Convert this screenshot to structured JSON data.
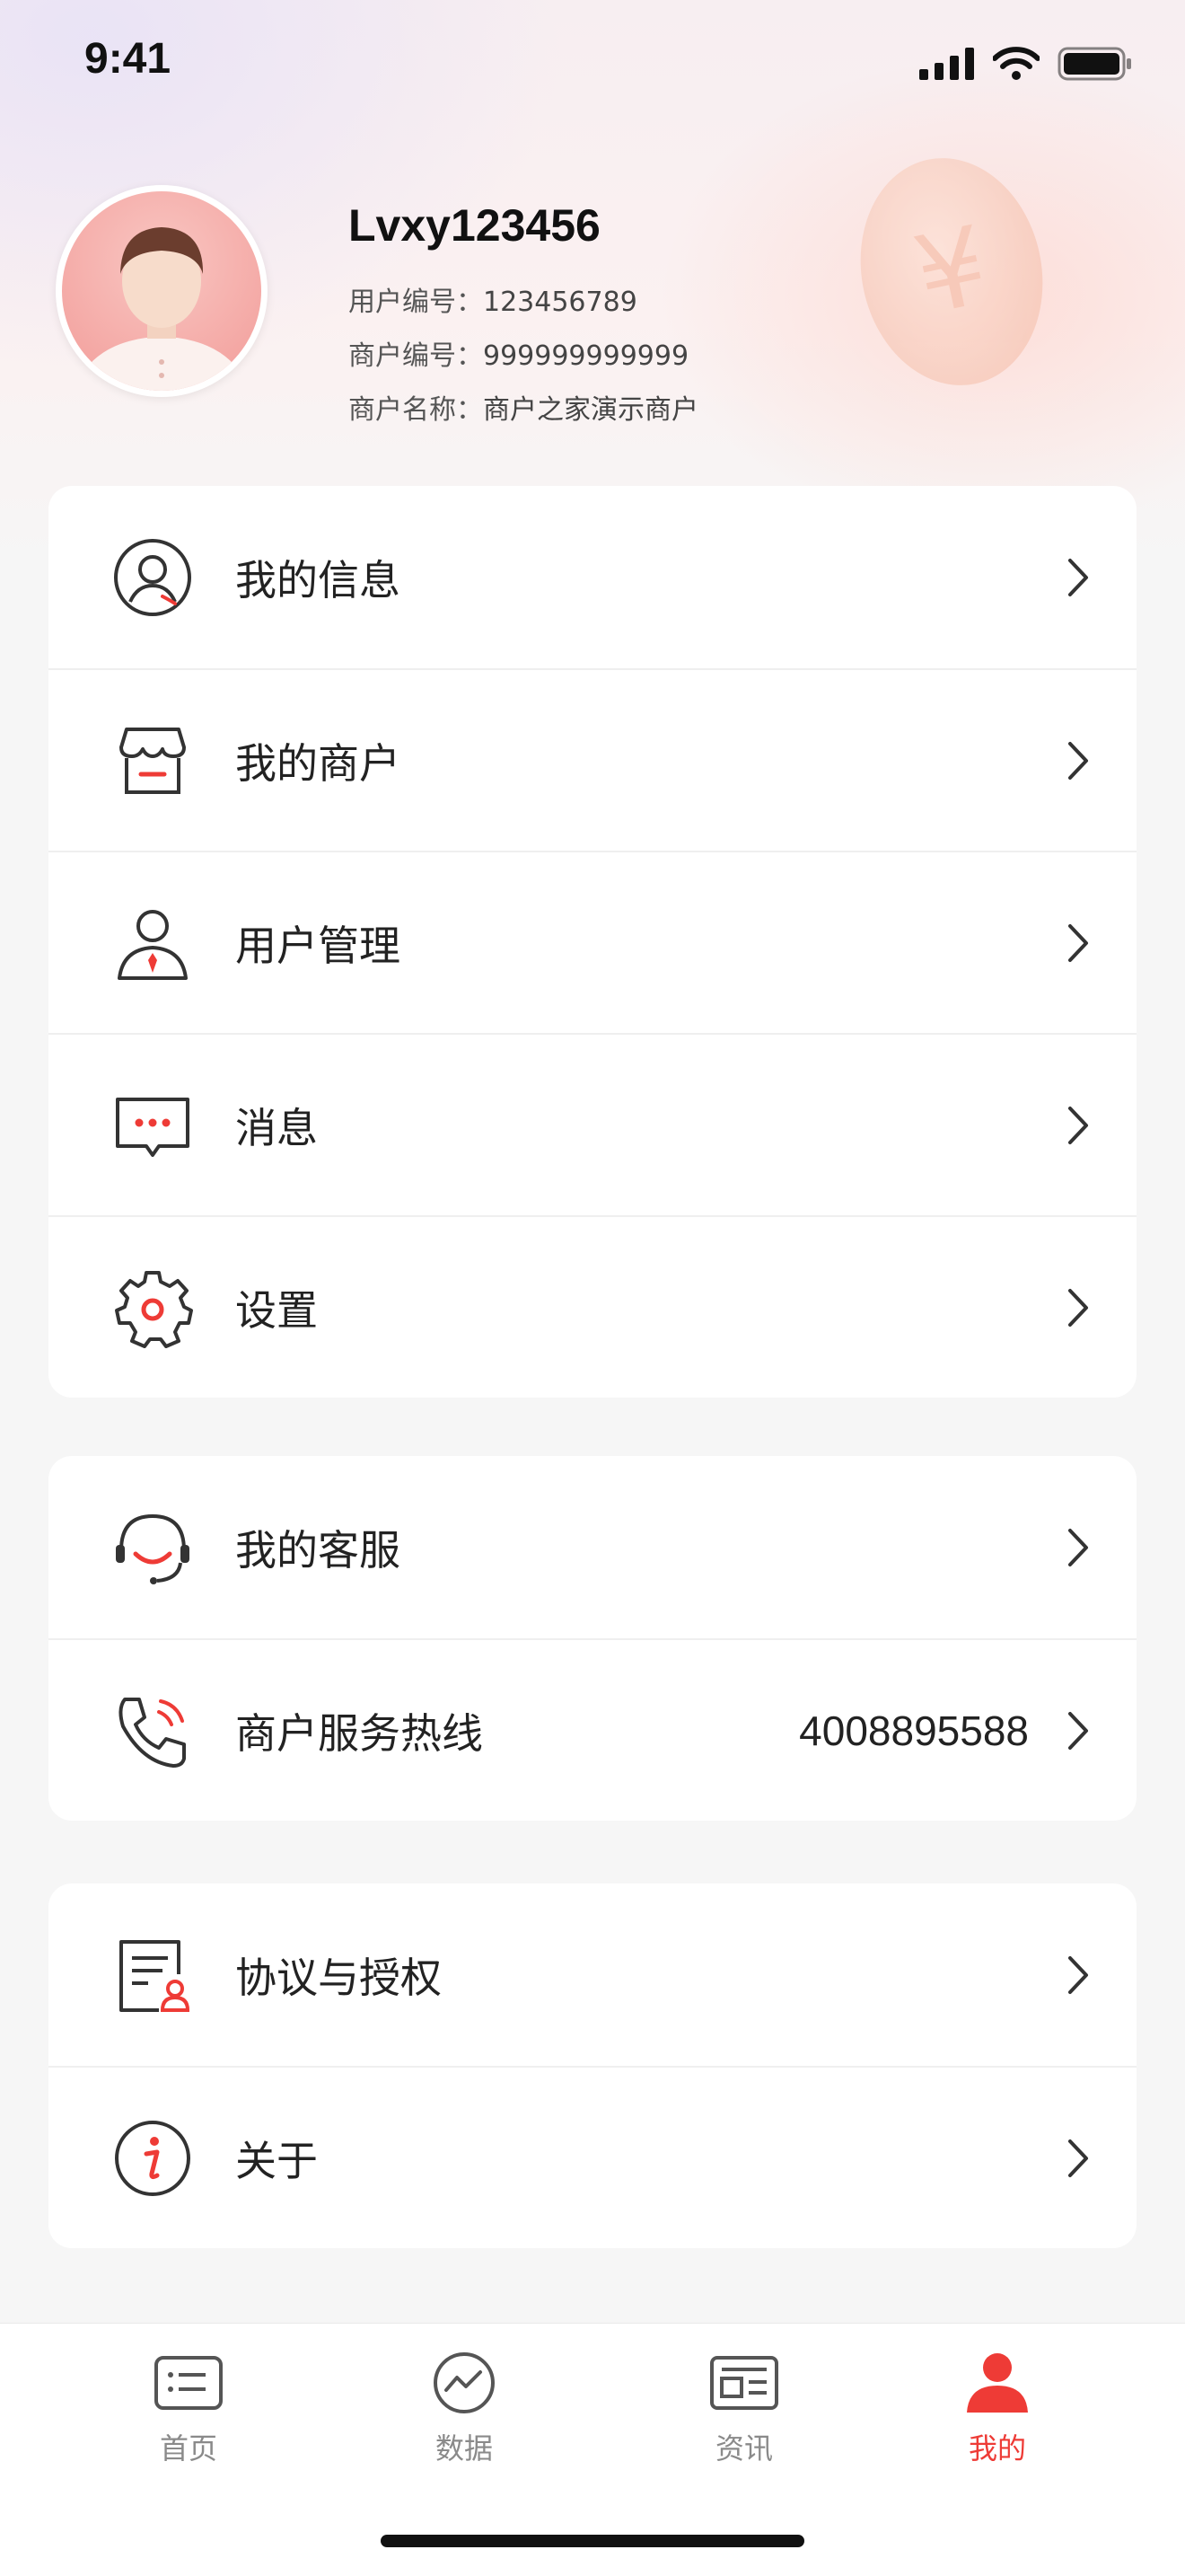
{
  "status_bar": {
    "time": "9:41"
  },
  "profile": {
    "username": "Lvxy123456",
    "user_id_label": "用户编号：",
    "user_id": "123456789",
    "merchant_id_label": "商户编号：",
    "merchant_id": "999999999999",
    "merchant_name_label": "商户名称：",
    "merchant_name": "商户之家演示商户"
  },
  "menu_group_1": [
    {
      "label": "我的信息",
      "icon": "user-circle-icon"
    },
    {
      "label": "我的商户",
      "icon": "store-icon"
    },
    {
      "label": "用户管理",
      "icon": "user-tie-icon"
    },
    {
      "label": "消息",
      "icon": "message-icon"
    },
    {
      "label": "设置",
      "icon": "gear-icon"
    }
  ],
  "menu_group_2": [
    {
      "label": "我的客服",
      "icon": "headset-icon"
    },
    {
      "label": "商户服务热线",
      "icon": "phone-icon",
      "value": "4008895588"
    }
  ],
  "menu_group_3": [
    {
      "label": "协议与授权",
      "icon": "agreement-icon"
    },
    {
      "label": "关于",
      "icon": "info-icon"
    }
  ],
  "tabbar": {
    "tabs": [
      {
        "label": "首页",
        "icon": "home-list-icon"
      },
      {
        "label": "数据",
        "icon": "chart-icon"
      },
      {
        "label": "资讯",
        "icon": "news-icon"
      },
      {
        "label": "我的",
        "icon": "person-icon",
        "active": true
      }
    ]
  },
  "colors": {
    "accent": "#ee3b36",
    "text": "#222222",
    "muted": "#8a8a8a"
  }
}
